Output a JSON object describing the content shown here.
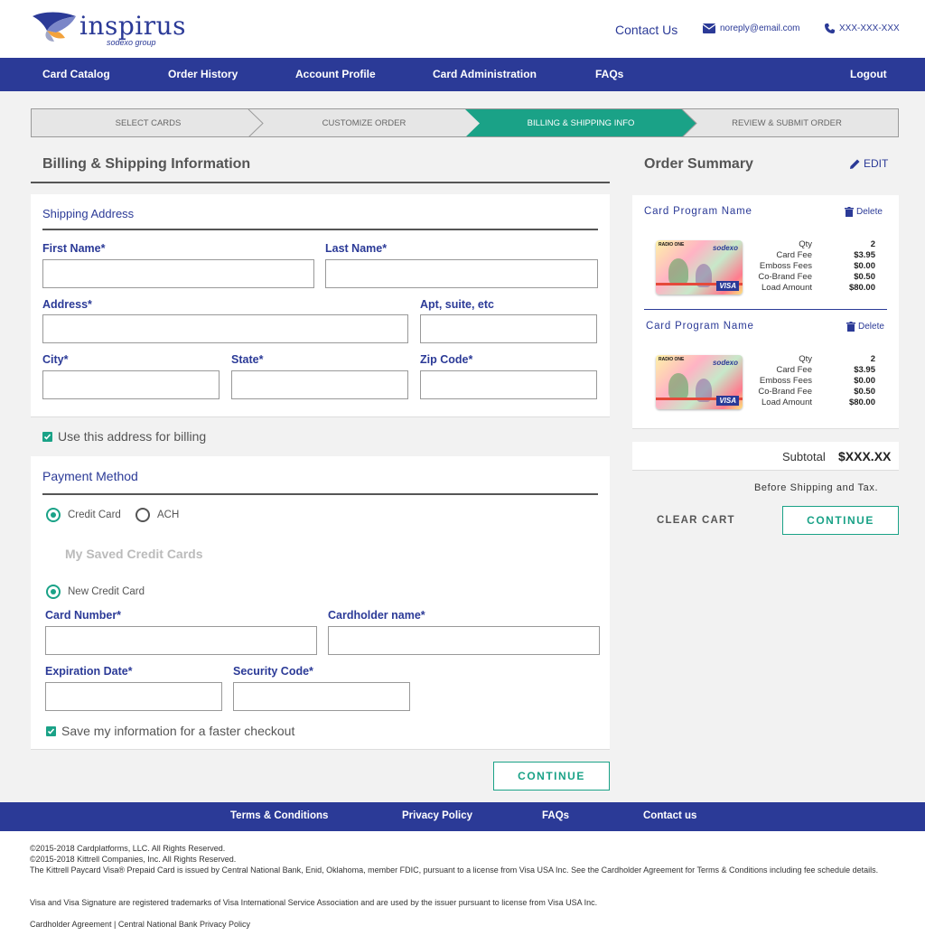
{
  "header": {
    "logo_text": "inspirus",
    "logo_sub": "sodexo group",
    "contact_label": "Contact Us",
    "email": "noreply@email.com",
    "phone": "XXX-XXX-XXX"
  },
  "nav": {
    "items": [
      "Card Catalog",
      "Order History",
      "Account Profile",
      "Card Administration",
      "FAQs"
    ],
    "logout": "Logout"
  },
  "stepper": {
    "steps": [
      "SELECT CARDS",
      "CUSTOMIZE ORDER",
      "BILLING & SHIPPING INFO",
      "REVIEW & SUBMIT ORDER"
    ],
    "active_index": 2
  },
  "billing": {
    "title": "Billing & Shipping Information",
    "shipping": {
      "title": "Shipping Address",
      "first_name": "First Name*",
      "last_name": "Last Name*",
      "address": "Address*",
      "apt": "Apt, suite, etc",
      "city": "City*",
      "state": "State*",
      "zip": "Zip Code*"
    },
    "use_for_billing": "Use this address for billing",
    "payment": {
      "title": "Payment Method",
      "credit_card": "Credit Card",
      "ach": "ACH",
      "saved_cards": "My Saved Credit Cards",
      "new_card": "New Credit Card",
      "card_number": "Card Number*",
      "cardholder": "Cardholder name*",
      "expiration": "Expiration Date*",
      "security": "Security Code*",
      "save_info": "Save my information for a faster checkout"
    },
    "continue": "CONTINUE"
  },
  "summary": {
    "title": "Order Summary",
    "edit": "EDIT",
    "items": [
      {
        "name": "Card Program Name",
        "delete": "Delete",
        "card_brand": "RADIO ONE",
        "card_issuer": "sodexo",
        "card_network": "VISA",
        "labels": [
          "Qty",
          "Card Fee",
          "Emboss Fees",
          "Co-Brand Fee",
          "Load Amount"
        ],
        "values": [
          "2",
          "$3.95",
          "$0.00",
          "$0.50",
          "$80.00"
        ]
      },
      {
        "name": "Card Program Name",
        "delete": "Delete",
        "card_brand": "RADIO ONE",
        "card_issuer": "sodexo",
        "card_network": "VISA",
        "labels": [
          "Qty",
          "Card Fee",
          "Emboss Fees",
          "Co-Brand Fee",
          "Load Amount"
        ],
        "values": [
          "2",
          "$3.95",
          "$0.00",
          "$0.50",
          "$80.00"
        ]
      }
    ],
    "subtotal_label": "Subtotal",
    "subtotal_value": "$XXX.XX",
    "tax_note": "Before Shipping and Tax.",
    "clear_cart": "CLEAR CART",
    "continue": "CONTINUE"
  },
  "footer": {
    "links": [
      "Terms & Conditions",
      "Privacy Policy",
      "FAQs",
      "Contact us"
    ],
    "legal": [
      "©2015-2018 Cardplatforms, LLC. All Rights Reserved.",
      "©2015-2018 Kittrell Companies, Inc. All Rights Reserved.",
      "The Kittrell Paycard Visa® Prepaid Card is issued by Central National Bank, Enid, Oklahoma, member FDIC, pursuant to a license from Visa USA Inc. See the Cardholder Agreement for Terms & Conditions including fee schedule details.",
      "Visa and Visa Signature are registered trademarks of Visa International Service Association and are used by the issuer pursuant to license from Visa USA Inc.",
      "Cardholder Agreement | Central National Bank Privacy Policy"
    ]
  },
  "colors": {
    "brand_blue": "#2b3a97",
    "accent_green": "#1aa287"
  }
}
